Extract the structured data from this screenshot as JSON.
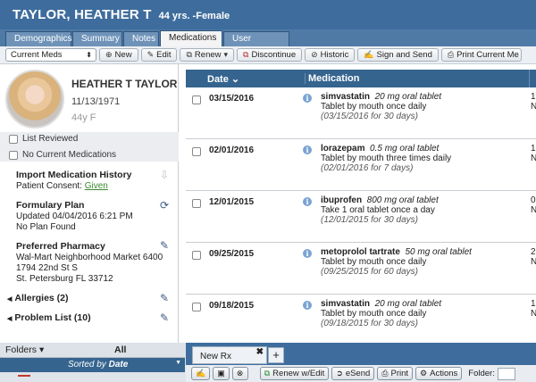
{
  "header": {
    "name": "TAYLOR, HEATHER T",
    "age_sex": "44 yrs. -Female"
  },
  "tabs": [
    "Demographics",
    "Summary",
    "Notes",
    "Medications",
    "User Defined"
  ],
  "toolbar": {
    "filter_value": "Current Meds",
    "new": "New",
    "edit": "Edit",
    "renew": "Renew",
    "discontinue": "Discontinue",
    "historic": "Historic",
    "sign_send": "Sign and Send",
    "print_current": "Print Current Me"
  },
  "patient": {
    "name": "HEATHER T TAYLOR",
    "dob": "11/13/1971",
    "age_sex": "44y F",
    "list_reviewed": "List Reviewed",
    "no_current_meds": "No Current Medications",
    "import_title": "Import Medication History",
    "consent_label": "Patient Consent:",
    "consent_value": "Given",
    "formulary_title": "Formulary Plan",
    "formulary_updated": "Updated 04/04/2016 6:21 PM",
    "formulary_status": "No Plan Found",
    "pharmacy_title": "Preferred Pharmacy",
    "pharmacy_name": "Wal-Mart Neighborhood Market 6400",
    "pharmacy_addr1": "1794 22nd St S",
    "pharmacy_addr2": "St. Petersburg FL 33712",
    "allergies": "Allergies (2)",
    "problems": "Problem List (10)"
  },
  "grid": {
    "col_date": "Date",
    "col_medication": "Medication",
    "rows": [
      {
        "date": "03/15/2016",
        "drug": "simvastatin",
        "dose": "20 mg oral tablet",
        "sig": "Tablet by mouth once daily",
        "dur": "(03/15/2016 for 30 days)",
        "c1": "1",
        "c2": "N"
      },
      {
        "date": "02/01/2016",
        "drug": "lorazepam",
        "dose": "0.5 mg oral tablet",
        "sig": "Tablet by mouth three times daily",
        "dur": "(02/01/2016 for 7 days)",
        "c1": "1",
        "c2": "N"
      },
      {
        "date": "12/01/2015",
        "drug": "ibuprofen",
        "dose": "800 mg oral tablet",
        "sig": "Take 1 oral tablet once a day",
        "dur": "(12/01/2015 for 30 days)",
        "c1": "0",
        "c2": "N"
      },
      {
        "date": "09/25/2015",
        "drug": "metoprolol tartrate",
        "dose": "50 mg oral tablet",
        "sig": "Tablet by mouth once daily",
        "dur": "(09/25/2015 for 60 days)",
        "c1": "2",
        "c2": "N"
      },
      {
        "date": "09/18/2015",
        "drug": "simvastatin",
        "dose": "20 mg oral tablet",
        "sig": "Tablet by mouth once daily",
        "dur": "(09/18/2015 for 30 days)",
        "c1": "1",
        "c2": "N"
      }
    ]
  },
  "bottom": {
    "folders": "Folders",
    "all": "All",
    "sorted_by": "Sorted by",
    "sorted_field": "Date",
    "rx_tab": "New Rx",
    "renew_edit": "Renew w/Edit",
    "esend": "eSend",
    "print": "Print",
    "actions": "Actions",
    "folder_label": "Folder:"
  }
}
